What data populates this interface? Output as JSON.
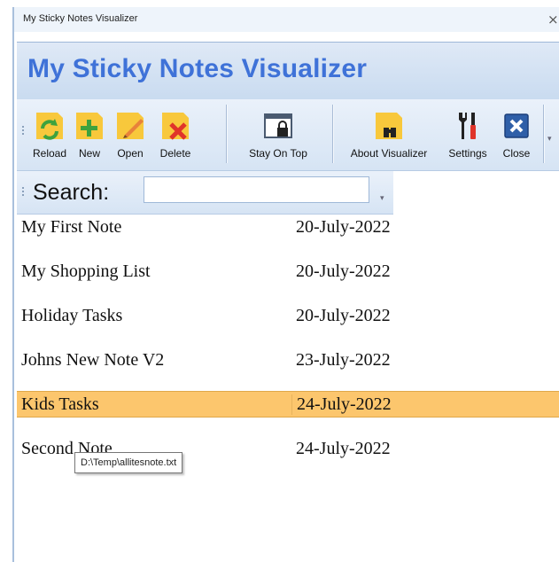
{
  "window": {
    "title": "My Sticky Notes Visualizer",
    "close_glyph": "×"
  },
  "banner": {
    "title": "My Sticky Notes Visualizer"
  },
  "toolbar": {
    "reload": "Reload",
    "new": "New",
    "open": "Open",
    "delete": "Delete",
    "stay_on_top": "Stay On Top",
    "about": "About Visualizer",
    "settings": "Settings",
    "close": "Close"
  },
  "search": {
    "label": "Search:",
    "value": ""
  },
  "notes": [
    {
      "name": "My First Note",
      "date": "20-July-2022",
      "selected": false
    },
    {
      "name": "My Shopping List",
      "date": "20-July-2022",
      "selected": false
    },
    {
      "name": "Holiday Tasks",
      "date": "20-July-2022",
      "selected": false
    },
    {
      "name": "Johns New Note V2",
      "date": "23-July-2022",
      "selected": false
    },
    {
      "name": "Kids Tasks",
      "date": "24-July-2022",
      "selected": true
    },
    {
      "name": "Second Note",
      "date": "24-July-2022",
      "selected": false
    }
  ],
  "tooltip": {
    "text": "D:\\Temp\\allitesnote.txt"
  },
  "colors": {
    "banner_text": "#3f72d8",
    "note_yellow": "#f8c83c",
    "selection": "#fcc66d",
    "reload_green": "#3ea23e",
    "delete_red": "#e0342a",
    "close_blue": "#2f5fa8"
  },
  "icons": {
    "reload": "reload-icon",
    "new": "new-note-icon",
    "open": "open-note-icon",
    "delete": "delete-note-icon",
    "stay_on_top": "window-lock-icon",
    "about": "binoculars-note-icon",
    "settings": "tools-icon",
    "close": "close-icon"
  }
}
